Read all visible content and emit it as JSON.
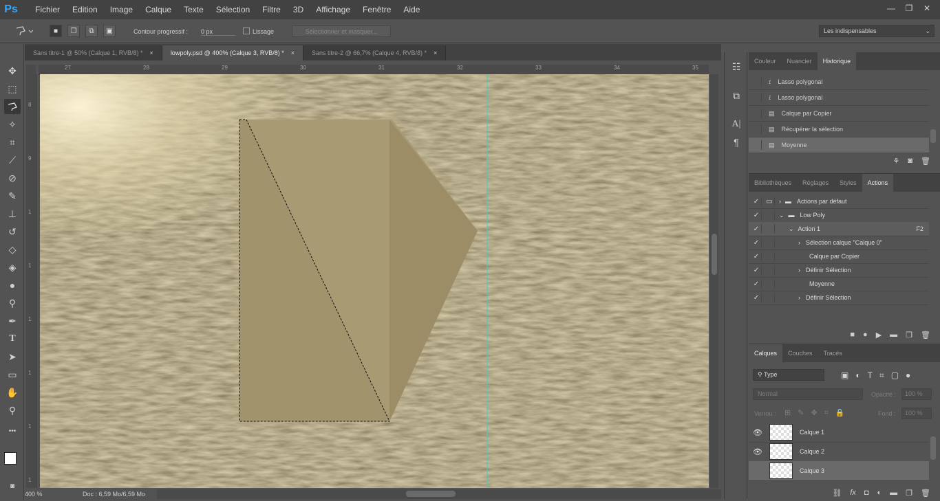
{
  "app": {
    "logo": "Ps"
  },
  "menu": [
    "Fichier",
    "Edition",
    "Image",
    "Calque",
    "Texte",
    "Sélection",
    "Filtre",
    "3D",
    "Affichage",
    "Fenêtre",
    "Aide"
  ],
  "window_controls": {
    "minimize": "—",
    "restore": "❐",
    "close": "✕"
  },
  "options": {
    "feather_label": "Contour progressif :",
    "feather_value": "0 px",
    "smooth_label": "Lissage",
    "refine_label": "Sélectionner et masquer...",
    "workspace": "Les indispensables"
  },
  "tabs": [
    {
      "label": "Sans titre-1 @ 50% (Calque 1, RVB/8) *",
      "close": "×"
    },
    {
      "label": "lowpoly.psd @ 400% (Calque 3, RVB/8) *",
      "close": "×"
    },
    {
      "label": "Sans titre-2 @ 66,7% (Calque 4, RVB/8) *",
      "close": "×"
    }
  ],
  "ruler_top": [
    "27",
    "28",
    "29",
    "30",
    "31",
    "32",
    "33",
    "34",
    "35"
  ],
  "ruler_left": [
    "8",
    "9",
    "1",
    "1",
    "1",
    "1",
    "1",
    "1"
  ],
  "status": {
    "zoom": "400 %",
    "doc": "Doc : 6,59 Mo/6,59 Mo"
  },
  "history": {
    "tabs": [
      "Couleur",
      "Nuancier",
      "Historique"
    ],
    "items": [
      "Lasso polygonal",
      "Lasso polygonal",
      "Calque par Copier",
      "Récupérer la sélection",
      "Moyenne"
    ]
  },
  "actions": {
    "tabs": [
      "Bibliothèques",
      "Réglages",
      "Styles",
      "Actions"
    ],
    "items": [
      {
        "label": "Actions par défaut",
        "key": ""
      },
      {
        "label": "Low Poly",
        "key": ""
      },
      {
        "label": "Action 1",
        "key": "F2"
      },
      {
        "label": "Sélection calque \"Calque 0\"",
        "key": ""
      },
      {
        "label": "Calque par Copier",
        "key": ""
      },
      {
        "label": "Définir Sélection",
        "key": ""
      },
      {
        "label": "Moyenne",
        "key": ""
      },
      {
        "label": "Définir Sélection",
        "key": ""
      }
    ]
  },
  "layers": {
    "tabs": [
      "Calques",
      "Couches",
      "Tracés"
    ],
    "filter": "Type",
    "blend": "Normal",
    "opacity_label": "Opacité :",
    "opacity": "100 %",
    "lock_label": "Verrou :",
    "fill_label": "Fond :",
    "fill": "100 %",
    "items": [
      "Calque 1",
      "Calque 2",
      "Calque 3"
    ]
  },
  "colors": {
    "accent_selection": "#6a6a6a",
    "guide": "#37d3c9"
  }
}
